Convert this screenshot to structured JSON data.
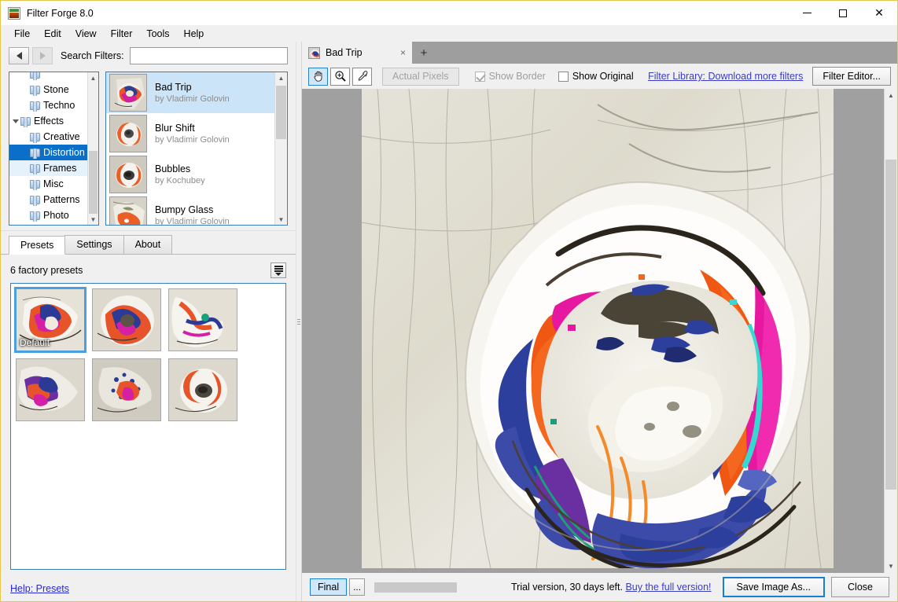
{
  "window": {
    "title": "Filter Forge 8.0",
    "icon": "app-icon",
    "minimize": "—",
    "maximize": "□",
    "close": "✕"
  },
  "menubar": {
    "items": [
      {
        "label": "File"
      },
      {
        "label": "Edit"
      },
      {
        "label": "View"
      },
      {
        "label": "Filter"
      },
      {
        "label": "Tools"
      },
      {
        "label": "Help"
      }
    ]
  },
  "browser": {
    "back_icon": "back-arrow-icon",
    "forward_icon": "forward-arrow-icon",
    "search_label": "Search Filters:",
    "search_value": "",
    "search_placeholder": "",
    "tree": [
      {
        "label": "Stone",
        "indent": 1,
        "state": "normal",
        "expander": "none"
      },
      {
        "label": "Techno",
        "indent": 1,
        "state": "normal",
        "expander": "none"
      },
      {
        "label": "Effects",
        "indent": 0,
        "state": "normal",
        "expander": "expanded"
      },
      {
        "label": "Creative",
        "indent": 1,
        "state": "normal",
        "expander": "none"
      },
      {
        "label": "Distortion",
        "indent": 1,
        "state": "selected",
        "expander": "none"
      },
      {
        "label": "Frames",
        "indent": 1,
        "state": "hover",
        "expander": "none"
      },
      {
        "label": "Misc",
        "indent": 1,
        "state": "normal",
        "expander": "none"
      },
      {
        "label": "Patterns",
        "indent": 1,
        "state": "normal",
        "expander": "none"
      },
      {
        "label": "Photo",
        "indent": 1,
        "state": "normal",
        "expander": "none"
      }
    ],
    "filters": [
      {
        "name": "Bad Trip",
        "author": "by Vladimir Golovin",
        "selected": true
      },
      {
        "name": "Blur Shift",
        "author": "by Vladimir Golovin",
        "selected": false
      },
      {
        "name": "Bubbles",
        "author": "by Kochubey",
        "selected": false
      },
      {
        "name": "Bumpy Glass",
        "author": "by Vladimir Golovin",
        "selected": false
      }
    ]
  },
  "lower_left": {
    "tabs": [
      {
        "label": "Presets",
        "active": true
      },
      {
        "label": "Settings",
        "active": false
      },
      {
        "label": "About",
        "active": false
      }
    ],
    "preset_count": "6 factory presets",
    "menu_button_icon": "list-menu-icon",
    "presets": [
      {
        "label": "Default",
        "selected": true
      },
      {
        "label": "",
        "selected": false
      },
      {
        "label": "",
        "selected": false
      },
      {
        "label": "",
        "selected": false
      },
      {
        "label": "",
        "selected": false
      },
      {
        "label": "",
        "selected": false
      }
    ],
    "help_link": "Help: Presets"
  },
  "document": {
    "tab_label": "Bad Trip",
    "tab_close": "×",
    "tab_add": "+"
  },
  "toolbar": {
    "hand_icon": "hand-tool-icon",
    "zoom_icon": "zoom-tool-icon",
    "eyedropper_icon": "eyedropper-tool-icon",
    "actual_pixels": "Actual Pixels",
    "show_border": "Show Border",
    "show_border_checked": true,
    "show_original": "Show Original",
    "show_original_checked": false,
    "library_link": "Filter Library: Download more filters",
    "filter_editor": "Filter Editor..."
  },
  "statusbar": {
    "final": "Final",
    "dots": "...",
    "trial_text": "Trial version, 30 days left.",
    "buy_link": "Buy the full version!",
    "save_image": "Save Image As...",
    "close": "Close"
  },
  "colors": {
    "accent_blue": "#0b6fc9",
    "link_blue": "#3b3bc4",
    "selection_light": "#cce4f7",
    "window_border": "#e8c44a",
    "chrome": "#f0f0f0",
    "canvas_bg": "#a0a0a0"
  }
}
